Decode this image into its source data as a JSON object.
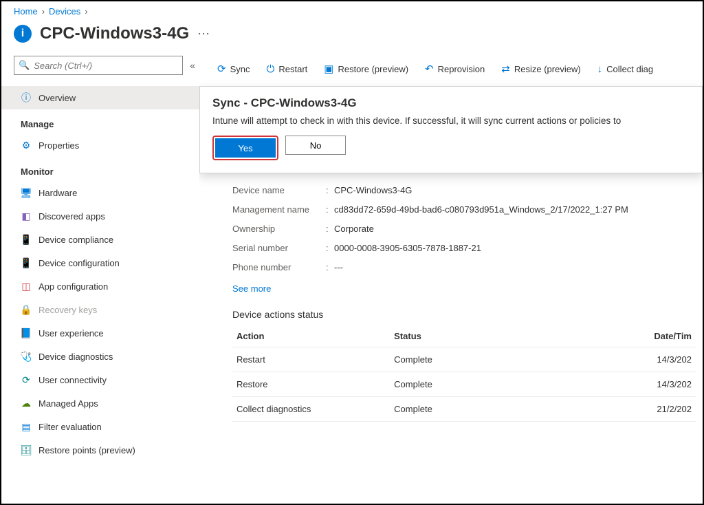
{
  "breadcrumbs": {
    "home": "Home",
    "devices": "Devices"
  },
  "page_title": "CPC-Windows3-4G",
  "search": {
    "placeholder": "Search (Ctrl+/)"
  },
  "sidebar": {
    "overview": "Overview",
    "manage": "Manage",
    "properties": "Properties",
    "monitor": "Monitor",
    "hardware": "Hardware",
    "discovered_apps": "Discovered apps",
    "device_compliance": "Device compliance",
    "device_configuration": "Device configuration",
    "app_configuration": "App configuration",
    "recovery_keys": "Recovery keys",
    "user_experience": "User experience",
    "device_diagnostics": "Device diagnostics",
    "user_connectivity": "User connectivity",
    "managed_apps": "Managed Apps",
    "filter_evaluation": "Filter evaluation",
    "restore_points": "Restore points (preview)"
  },
  "toolbar": {
    "sync": "Sync",
    "restart": "Restart",
    "restore": "Restore (preview)",
    "reprovision": "Reprovision",
    "resize": "Resize (preview)",
    "collect": "Collect diag"
  },
  "popup": {
    "title": "Sync - CPC-Windows3-4G",
    "body": "Intune will attempt to check in with this device. If successful, it will sync current actions or policies to",
    "yes": "Yes",
    "no": "No"
  },
  "details": {
    "device_name_k": "Device name",
    "device_name_v": "CPC-Windows3-4G",
    "mgmt_name_k": "Management name",
    "mgmt_name_v": "cd83dd72-659d-49bd-bad6-c080793d951a_Windows_2/17/2022_1:27 PM",
    "ownership_k": "Ownership",
    "ownership_v": "Corporate",
    "serial_k": "Serial number",
    "serial_v": "0000-0008-3905-6305-7878-1887-21",
    "phone_k": "Phone number",
    "phone_v": "---",
    "see_more": "See more"
  },
  "actions": {
    "head": "Device actions status",
    "col_action": "Action",
    "col_status": "Status",
    "col_date": "Date/Tim",
    "rows": [
      {
        "action": "Restart",
        "status": "Complete",
        "date": "14/3/202"
      },
      {
        "action": "Restore",
        "status": "Complete",
        "date": "14/3/202"
      },
      {
        "action": "Collect diagnostics",
        "status": "Complete",
        "date": "21/2/202"
      }
    ]
  }
}
